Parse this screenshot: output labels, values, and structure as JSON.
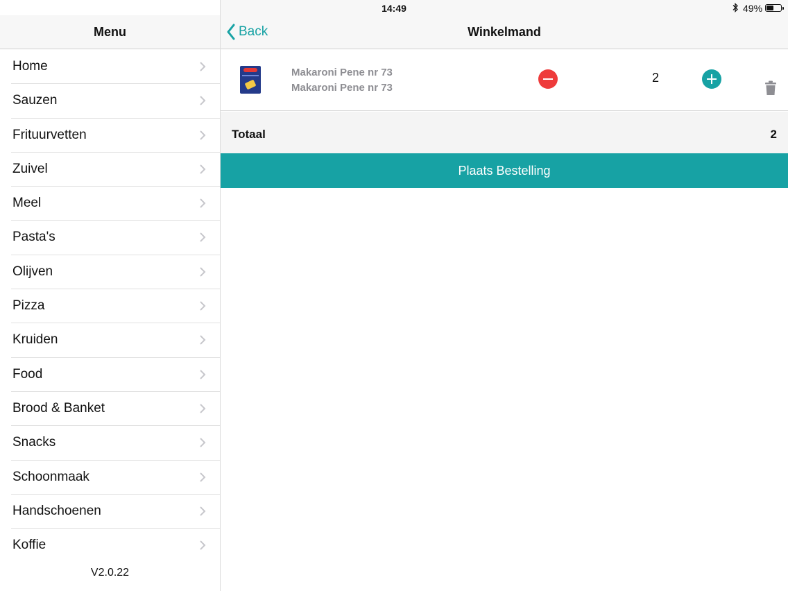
{
  "status_bar": {
    "time": "14:49",
    "battery_percent_label": "49%",
    "battery_level": 0.49
  },
  "sidebar": {
    "title": "Menu",
    "items": [
      {
        "label": "Home"
      },
      {
        "label": "Sauzen"
      },
      {
        "label": "Frituurvetten"
      },
      {
        "label": "Zuivel"
      },
      {
        "label": "Meel"
      },
      {
        "label": "Pasta's"
      },
      {
        "label": "Olijven"
      },
      {
        "label": "Pizza"
      },
      {
        "label": "Kruiden"
      },
      {
        "label": "Food"
      },
      {
        "label": "Brood & Banket"
      },
      {
        "label": "Snacks"
      },
      {
        "label": "Schoonmaak"
      },
      {
        "label": "Handschoenen"
      },
      {
        "label": "Koffie"
      }
    ],
    "version": "V2.0.22"
  },
  "header": {
    "back_label": "Back",
    "title": "Winkelmand"
  },
  "cart": {
    "items": [
      {
        "name_line1": "Makaroni Pene nr 73",
        "name_line2": "Makaroni Pene nr 73",
        "quantity": "2"
      }
    ],
    "total_label": "Totaal",
    "total_value": "2",
    "order_button_label": "Plaats Bestelling"
  },
  "colors": {
    "accent": "#17a2a4",
    "minus": "#ee3b3b",
    "muted_text": "#8e8e93"
  }
}
